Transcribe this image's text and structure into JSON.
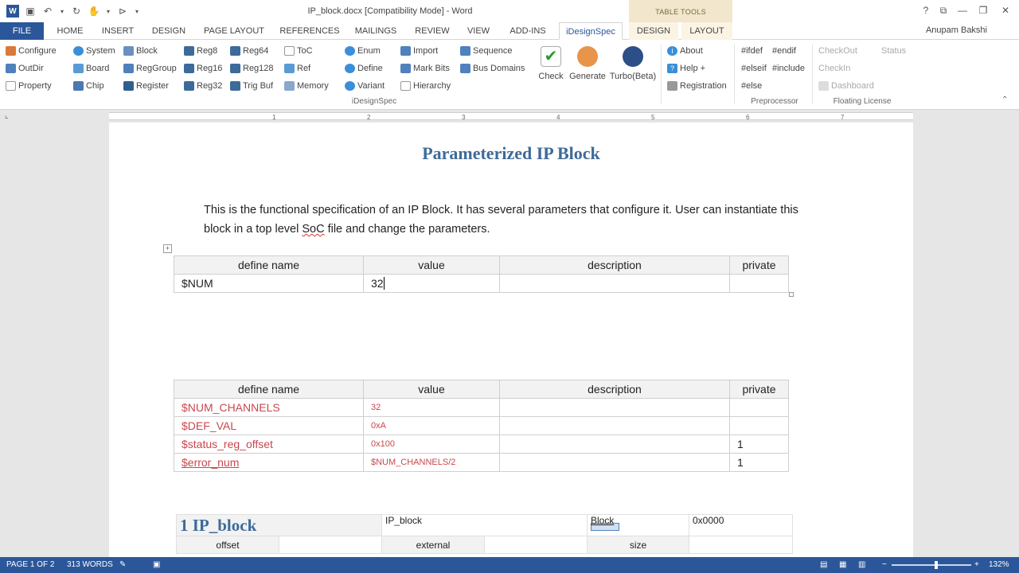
{
  "titlebar": {
    "document_title": "IP_block.docx [Compatibility Mode] - Word",
    "context_band": "TABLE TOOLS",
    "window_controls": [
      "?",
      "⧉",
      "—",
      "❐",
      "✕"
    ]
  },
  "tabs": {
    "file": "FILE",
    "items": [
      "HOME",
      "INSERT",
      "DESIGN",
      "PAGE LAYOUT",
      "REFERENCES",
      "MAILINGS",
      "REVIEW",
      "VIEW",
      "ADD-INS",
      "iDesignSpec"
    ],
    "context_items": [
      "DESIGN",
      "LAYOUT"
    ],
    "user": "Anupam Bakshi"
  },
  "ribbon": {
    "col1": [
      "Configure",
      "OutDir",
      "Property"
    ],
    "col2": [
      "System",
      "Board",
      "Chip"
    ],
    "col3": [
      "Block",
      "RegGroup",
      "Register"
    ],
    "col4": [
      "Reg8",
      "Reg16",
      "Reg32"
    ],
    "col5": [
      "Reg64",
      "Reg128",
      "Trig Buf"
    ],
    "col6": [
      "ToC",
      "Ref",
      "Memory"
    ],
    "col7": [
      "Enum",
      "Define",
      "Variant"
    ],
    "col8": [
      "Import",
      "Mark Bits",
      "Hierarchy"
    ],
    "col9": [
      "Sequence",
      "Bus Domains"
    ],
    "big": [
      "Check",
      "Generate",
      "Turbo(Beta)"
    ],
    "col10": [
      "About",
      "Help +",
      "Registration"
    ],
    "pre1": [
      "#ifdef",
      "#elseif",
      "#else"
    ],
    "pre2": [
      "#endif",
      "#include"
    ],
    "lic1": [
      "CheckOut",
      "CheckIn",
      "Dashboard"
    ],
    "lic2": [
      "Status"
    ],
    "group_idesignspec": "iDesignSpec",
    "group_preprocessor": "Preprocessor",
    "group_license": "Floating License"
  },
  "ruler": [
    "1",
    "2",
    "3",
    "4",
    "5",
    "6",
    "7"
  ],
  "document": {
    "heading": "Parameterized IP Block",
    "intro_before": "This is the functional specification of an IP Block. It has several parameters that configure it. User can instantiate this block in a top level ",
    "intro_soc": "SoC",
    "intro_after": " file and change the parameters.",
    "headers": [
      "define name",
      "value",
      "description",
      "private"
    ],
    "table1_rows": [
      {
        "name": "$NUM",
        "value": "32",
        "description": "",
        "private": ""
      }
    ],
    "table2_rows": [
      {
        "name": "$NUM_CHANNELS",
        "value": "32",
        "description": "",
        "private": ""
      },
      {
        "name": "$DEF_VAL",
        "value": "0xA",
        "description": "",
        "private": ""
      },
      {
        "name": "$status_reg_offset",
        "value": "0x100",
        "description": "",
        "private": "1"
      },
      {
        "name": "$error_num",
        "value": "$NUM_CHANNELS/2",
        "description": "",
        "private": "1"
      }
    ],
    "block_table": {
      "heading": "1 IP_block",
      "name": "IP_block",
      "type": "Block",
      "address": "0x0000",
      "labels": [
        "offset",
        "external",
        "size"
      ]
    }
  },
  "statusbar": {
    "page": "PAGE 1 OF 2",
    "words": "313 WORDS",
    "zoom": "132%"
  }
}
